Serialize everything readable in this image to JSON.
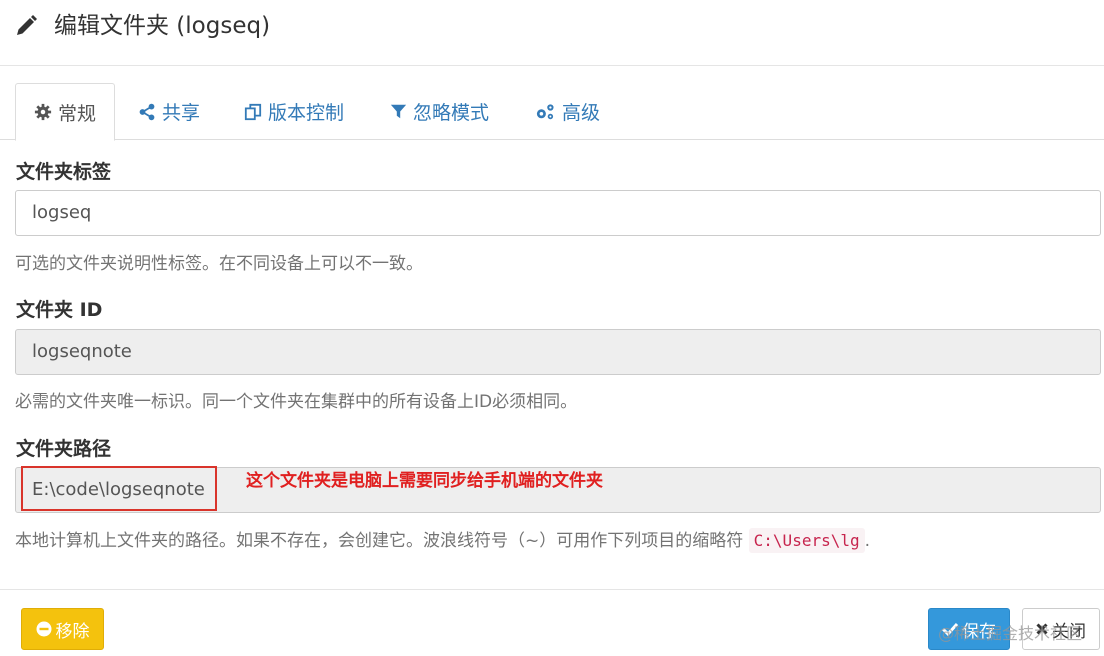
{
  "dialog": {
    "title": "编辑文件夹 (logseq)"
  },
  "tabs": [
    {
      "label": "常规",
      "icon": "gear-icon"
    },
    {
      "label": "共享",
      "icon": "share-icon"
    },
    {
      "label": "版本控制",
      "icon": "copy-icon"
    },
    {
      "label": "忽略模式",
      "icon": "filter-icon"
    },
    {
      "label": "高级",
      "icon": "cogs-icon"
    }
  ],
  "fields": {
    "label": {
      "title": "文件夹标签",
      "value": "logseq",
      "help": "可选的文件夹说明性标签。在不同设备上可以不一致。"
    },
    "id": {
      "title": "文件夹 ID",
      "value": "logseqnote",
      "help": "必需的文件夹唯一标识。同一个文件夹在集群中的所有设备上ID必须相同。"
    },
    "path": {
      "title": "文件夹路径",
      "value": "E:\\code\\logseqnote",
      "help_prefix": "本地计算机上文件夹的路径。如果不存在，会创建它。波浪线符号（~）可用作下列项目的缩略符",
      "help_code": "C:\\Users\\lg",
      "help_suffix": "."
    }
  },
  "annotation": {
    "text": "这个文件夹是电脑上需要同步给手机端的文件夹",
    "color": "#e02020"
  },
  "buttons": {
    "remove": "移除",
    "save": "保存",
    "close": "关闭"
  },
  "watermark": "@稀土掘金技术社区",
  "colors": {
    "link": "#337ab7",
    "remove_bg": "#f4c20d",
    "save_bg": "#3498db"
  }
}
